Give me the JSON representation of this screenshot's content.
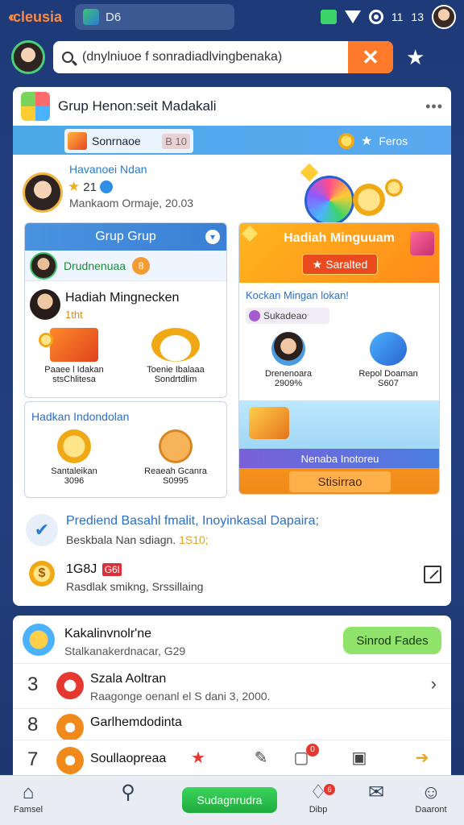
{
  "topbar": {
    "brand": "cleusia",
    "tab_title": "D6",
    "status_time": "11",
    "status_num": "13"
  },
  "search": {
    "value": "(dnylniuoe f sonradiadlvingbenaka)",
    "placeholder": "Search"
  },
  "main_card": {
    "title": "Grup Henon:seit Madakali",
    "tab_active": "Sonrnaoe",
    "tab_active_suffix": "B 10",
    "tab_right": "Feros",
    "profile": {
      "name": "Havanoei Ndan",
      "level": "21",
      "meta": "Mankaom Ormaje, 20.03"
    },
    "left_panel": {
      "header": "Grup Grup",
      "row1": "Drudnenuaa",
      "row1_badge": "8",
      "row2_title": "Hadiah Mingnecken",
      "row2_sub": "1tht",
      "items": [
        {
          "label": "Paaee l Idakan",
          "sub": "stsChlitesa"
        },
        {
          "label": "Toenie Ibalaaa",
          "sub": "Sondrtdlim"
        }
      ]
    },
    "left_panel2": {
      "header": "Hadkan Indondolan",
      "items": [
        {
          "label": "Santaleikan",
          "sub": "3096"
        },
        {
          "label": "Reaeah Gcanra",
          "sub": "S0995"
        }
      ]
    },
    "right_panel": {
      "banner_title": "Hadiah Minguuam",
      "banner_button": "Saralted",
      "sub": "Kockan Mingan lokan!",
      "chip": "Sukadeao",
      "items": [
        {
          "label": "Drenenoara",
          "sub": "2909%"
        },
        {
          "label": "Repol Doaman",
          "sub": "S607"
        }
      ],
      "banner2_caption": "Nenaba Inotoreu",
      "banner2_button": "Stisirrao"
    },
    "notification": {
      "title": "Prediend Basahl fmalit, Inoyinkasal Dapaira;",
      "sub_prefix": "Beskbala Nan sdiagn.",
      "sub_highlight": "1S10;"
    },
    "coin_row": {
      "coin_symbol": "$",
      "value": "1G8J",
      "tag": "G6l",
      "sub": "Rasdlak smikng, Srssillaing"
    }
  },
  "card2": {
    "head_title": "Kakalinvnolr'ne",
    "head_sub": "Stalkanakerdnacar, G29",
    "button": "Sinrod Fades",
    "rows": [
      {
        "num": "3",
        "title": "Szala Aoltran",
        "sub": "Raagonge oenanl el S dani 3, 2000."
      },
      {
        "num": "8",
        "title": "Garlhemdodinta"
      }
    ],
    "action_row": {
      "num": "7",
      "title": "Soullaopreaa"
    },
    "action_badge": "0"
  },
  "bottom_nav": {
    "items": [
      {
        "label": "Famsel",
        "icon": "home-icon"
      },
      {
        "label": "",
        "icon": "search-icon"
      },
      {
        "label": "Dibp",
        "icon": "bag-icon",
        "badge": "6"
      },
      {
        "label": "",
        "icon": "mail-icon"
      },
      {
        "label": "Daaront",
        "icon": "profile-icon"
      }
    ],
    "cta": "Sudagnrudra"
  }
}
